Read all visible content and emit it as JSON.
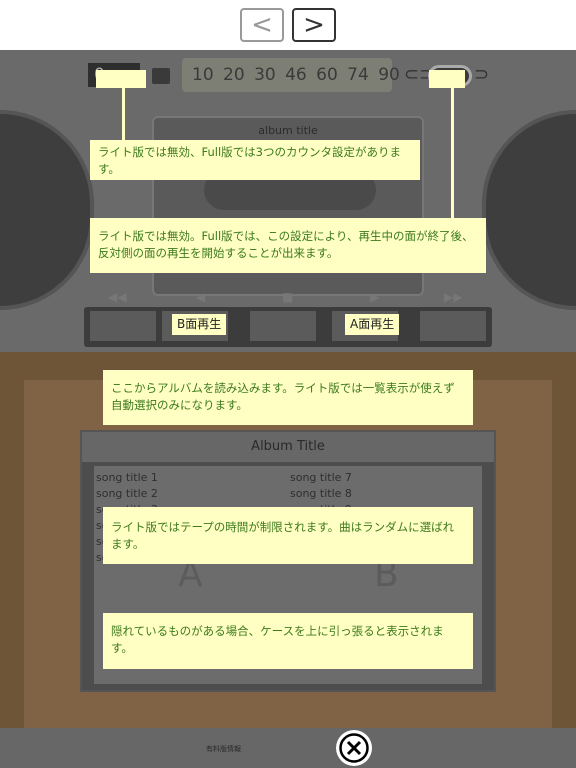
{
  "nav": {
    "prev_icon": "chevron-left-icon",
    "next_icon": "chevron-right-icon",
    "prev": "<",
    "next": ">"
  },
  "player": {
    "counter": "0",
    "scale": "10 20 30  46  60  74  90",
    "album_title": "album title",
    "buttons": [
      "",
      "B面再生",
      "",
      "A面再生",
      ""
    ]
  },
  "case": {
    "title": "Album Title",
    "songs_left": [
      "song title 1",
      "song title 2",
      "song title 3",
      "so",
      "so",
      "so"
    ],
    "songs_right": [
      "song title 7",
      "song title 8",
      "song title 9"
    ],
    "side_a": "A",
    "side_b": "B"
  },
  "tips": {
    "counter": "ライト版では無効、Full版では3つのカウンタ設定があります。",
    "autoreverse": "ライト版では無効。Full版では、この設定により、再生中の面が終了後、反対側の面の再生を開始することが出来ます。",
    "load": "ここからアルバムを読み込みます。ライト版では一覧表示が使えず自動選択のみになります。",
    "time": "ライト版ではテープの時間が制限されます。曲はランダムに選ばれます。",
    "hidden": "隠れているものがある場合、ケースを上に引っ張ると表示されます。"
  },
  "footer": {
    "paid_info": "有料版情報",
    "close_icon": "close-circle-icon"
  },
  "colors": {
    "tip_bg": "#ffffc4",
    "tip_text": "#3c7a1c"
  }
}
